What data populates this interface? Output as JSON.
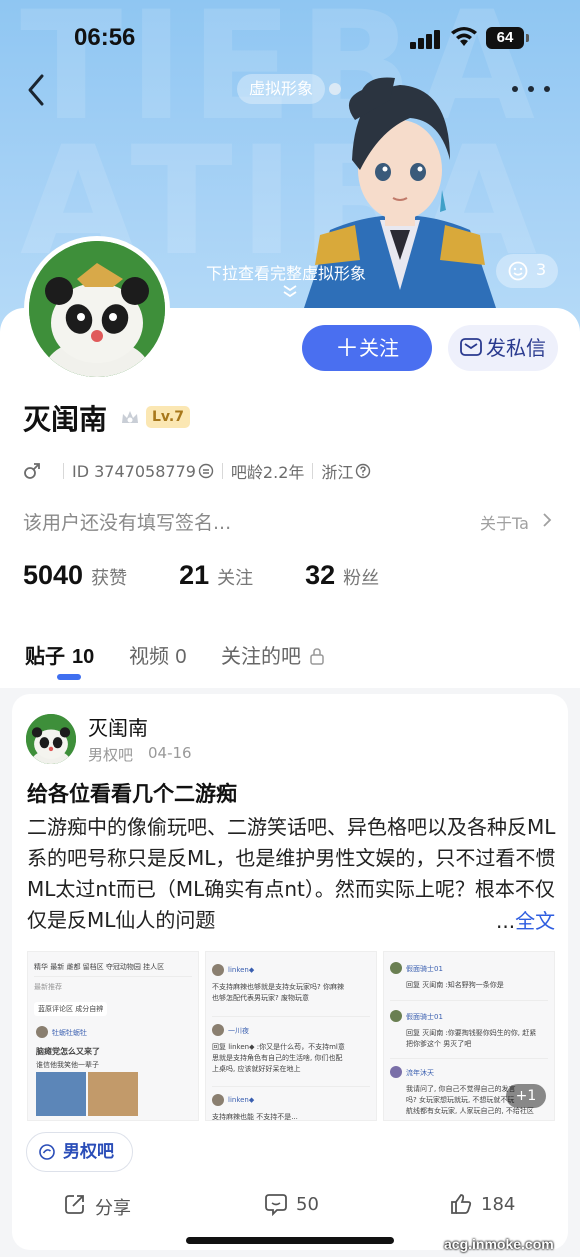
{
  "status_bar": {
    "time": "06:56",
    "battery": "64"
  },
  "header": {
    "tag": "虚拟形象",
    "pull_hint": "下拉查看完整虚拟形象",
    "like_count": "3"
  },
  "profile": {
    "username": "灭闺南",
    "level": "Lv.7",
    "id_text": "ID 3747058779",
    "age_text": "吧龄2.2年",
    "location": "浙江",
    "signature": "该用户还没有填写签名...",
    "about_label": "关于Ta",
    "follow_label": "关注",
    "dm_label": "发私信"
  },
  "stats": [
    {
      "num": "5040",
      "label": "获赞"
    },
    {
      "num": "21",
      "label": "关注"
    },
    {
      "num": "32",
      "label": "粉丝"
    }
  ],
  "tabs": [
    {
      "label": "贴子",
      "count": "10"
    },
    {
      "label": "视频",
      "count": "0"
    },
    {
      "label": "关注的吧"
    }
  ],
  "post": {
    "author": "灭闺南",
    "forum": "男权吧",
    "date": "04-16",
    "title": "给各位看看几个二游痴",
    "body": "二游痴中的像偷玩吧、二游笑话吧、异色格吧以及各种反ML系的吧号称只是反ML，也是维护男性文娱的，只不过看不惯ML太过nt而已（ML确实有点nt）。然而实际上呢？根本不仅仅是反ML仙人的问题",
    "more_dots": "...",
    "more_label": "全文",
    "image_more": "+1",
    "forum_pill": "男权吧",
    "share_label": "分享",
    "comments": "50",
    "likes": "184"
  },
  "thumbs": {
    "t1": {
      "tabs": "精华  最新  雌都  留档区  夺冠动物园  挂人区",
      "line1": "最新推荐",
      "chip": "蓝原评论区  成分自辨",
      "user": "牡蛎牡蛎牡",
      "title": "脑瘫党怎么又来了",
      "sub": "谁信他我笑他一辈子"
    },
    "t2": {
      "u1": "linken◆",
      "c1": "不支持麻辣也够就是支持女玩家吗? 你麻辣",
      "c1b": "也够怎配代表男玩家? 废物玩意",
      "u2": "一川夜",
      "c2": "回复 linken◆ :你又是什么苟，不支持ml意",
      "c2b": "思就是支持角色有自己的生活啥, 你们也配",
      "c2c": "上桌吗, 应该就好好呆在地上",
      "u3": "linken◆",
      "c3": "支持麻辣也能 不支持不是..."
    },
    "t3": {
      "u1": "假面骑士01",
      "c1": "回复 灭闺南 :知名野狗一条你是",
      "u2": "假面骑士01",
      "c2": "回复 灭闺南 :你要掏钱娶你妈生的你, 赶紧",
      "c2b": "把你爹这个 男灭了吧",
      "u3": "流年沐天",
      "c3": "我请问了, 你自己不觉得自己的发言",
      "c3b": "吗? 女玩家想玩就玩, 不想玩就不玩",
      "c3c": "航线都有女玩家, 人家玩自己的, 不给社区"
    }
  },
  "watermark": "acg.inmoke.com",
  "colors": {
    "accent": "#4a6ff0",
    "header_bg": "#9bcbf4",
    "level_bg": "#fbe7b3"
  }
}
